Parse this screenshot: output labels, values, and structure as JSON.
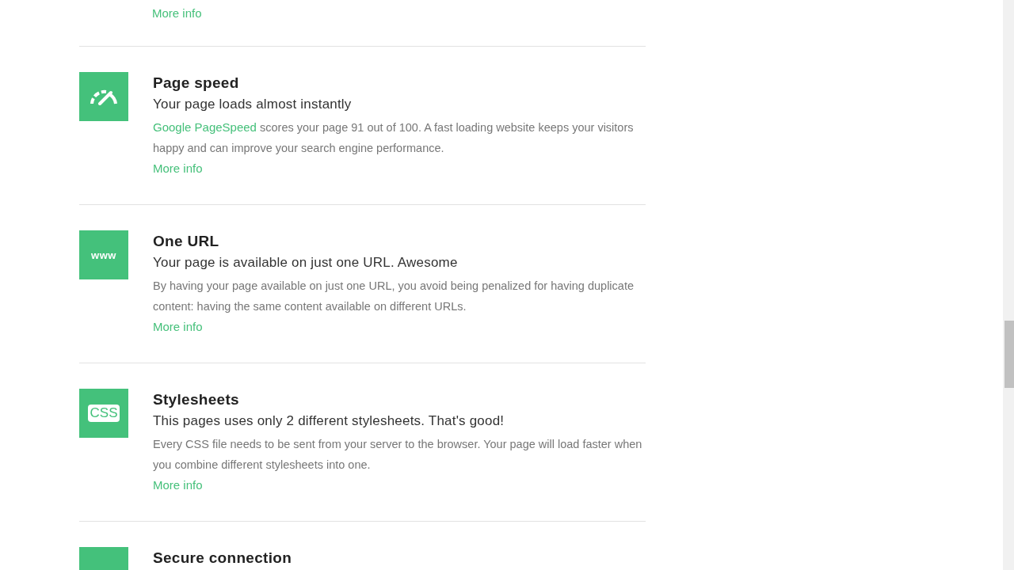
{
  "top_link": "More info",
  "sections": [
    {
      "icon": {
        "kind": "gauge"
      },
      "title": "Page speed",
      "subtitle": "Your page loads almost instantly",
      "link_lead": "Google PageSpeed",
      "body": "scores your page 91 out of 100. A fast loading website keeps your visitors happy and can improve your search engine performance.",
      "more": "More info"
    },
    {
      "icon": {
        "kind": "text",
        "text": "www"
      },
      "title": "One URL",
      "subtitle": "Your page is available on just one URL. Awesome",
      "body": "By having your page available on just one URL, you avoid being penalized for having duplicate content: having the same content available on different URLs.",
      "more": "More info"
    },
    {
      "icon": {
        "kind": "badge",
        "text": "CSS"
      },
      "title": "Stylesheets",
      "subtitle": "This pages uses only 2 different stylesheets. That's good!",
      "body": "Every CSS file needs to be sent from your server to the browser. Your page will load faster when you combine different stylesheets into one.",
      "more": "More info"
    },
    {
      "icon": {
        "kind": "blank"
      },
      "title": "Secure connection"
    }
  ]
}
